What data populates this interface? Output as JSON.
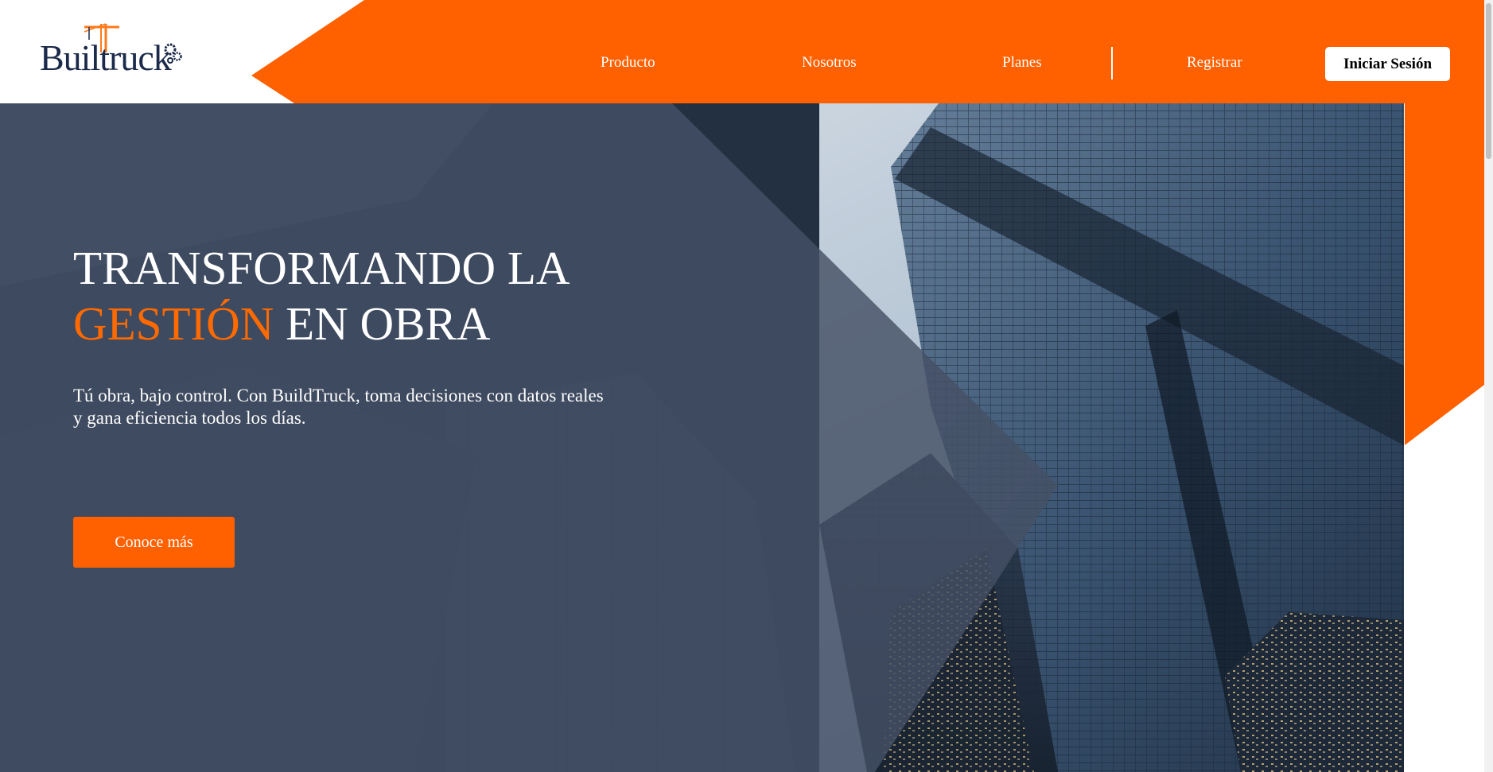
{
  "brand": {
    "logo_text": "Builtruck",
    "colors": {
      "accent": "#FF6000",
      "navy": "#1B2A4A",
      "hero_overlay": "#3E4B62"
    }
  },
  "nav": {
    "items": [
      {
        "label": "Producto"
      },
      {
        "label": "Nosotros"
      },
      {
        "label": "Planes"
      },
      {
        "label": "Registrar"
      }
    ],
    "login_label": "Iniciar Sesión"
  },
  "hero": {
    "title_line1": "TRANSFORMANDO LA",
    "title_accent": "GESTIÓN",
    "title_line2_rest": " EN OBRA",
    "subtitle": "Tú obra, bajo control. Con BuildTruck, toma decisiones con datos reales y gana eficiencia todos los días.",
    "cta_label": "Conoce más"
  }
}
